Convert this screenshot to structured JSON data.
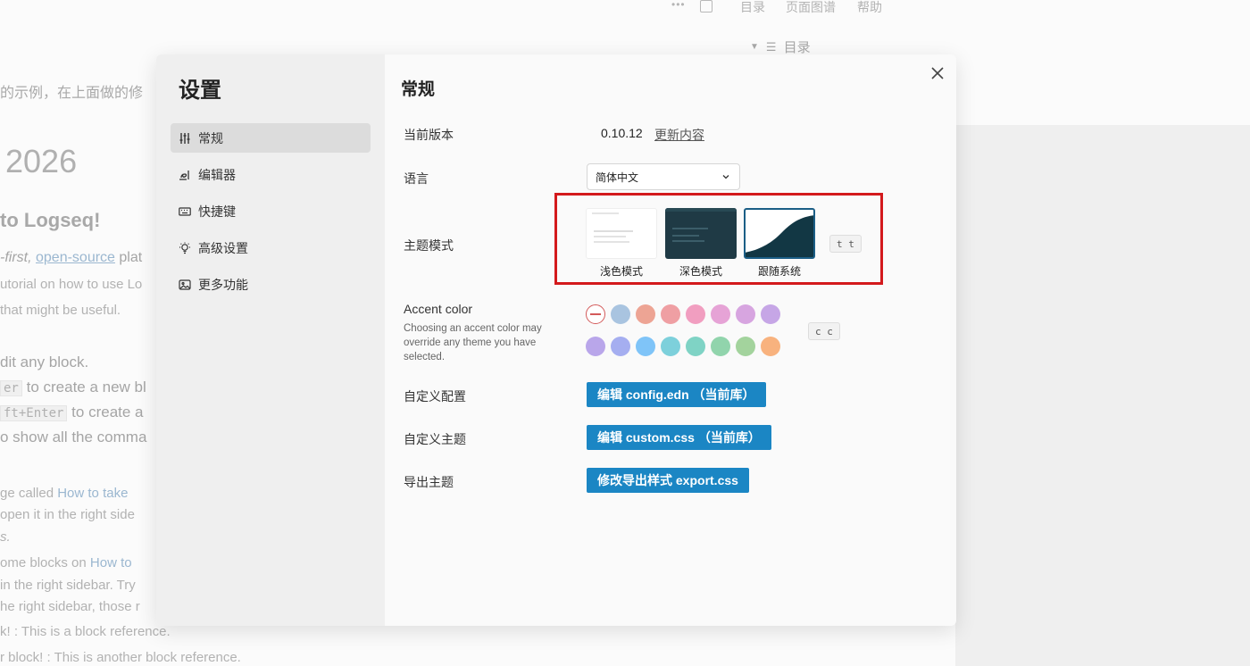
{
  "background": {
    "topbar": {
      "more": "•••",
      "toc": "目录",
      "graph": "页面图谱",
      "help": "帮助"
    },
    "toc_panel_label": "目录",
    "lines": [
      "的示例，在上面做的修",
      "2026",
      "to Logseq!",
      "-first,",
      "open-source",
      "plat",
      "utorial on how to use Lo",
      "that might be useful.",
      "dit any block.",
      "er",
      "to create a new bl",
      "ft+Enter",
      "to create a",
      "o show all the comma",
      "ge called",
      "How to take",
      "open it in the right side",
      "s.",
      "ome blocks on",
      "How to",
      "in the right sidebar. Try",
      "he right sidebar, those r",
      "k! : This is a block reference.",
      "r block! : This is another block reference."
    ]
  },
  "settings": {
    "title": "设置",
    "nav": [
      {
        "label": "常规",
        "icon": "sliders-icon",
        "active": true
      },
      {
        "label": "编辑器",
        "icon": "editor-icon",
        "active": false
      },
      {
        "label": "快捷键",
        "icon": "keyboard-icon",
        "active": false
      },
      {
        "label": "高级设置",
        "icon": "bulb-icon",
        "active": false
      },
      {
        "label": "更多功能",
        "icon": "image-icon",
        "active": false
      }
    ],
    "general": {
      "title": "常规",
      "version_label": "当前版本",
      "version": "0.10.12",
      "changelog": "更新内容",
      "language_label": "语言",
      "language_value": "简体中文",
      "theme_label": "主题模式",
      "themes": [
        "浅色模式",
        "深色模式",
        "跟随系统"
      ],
      "theme_selected": "跟随系统",
      "theme_shortcut": "t t",
      "accent_label": "Accent color",
      "accent_desc": "Choosing an accent color may override any theme you have selected.",
      "accent_shortcut": "c c",
      "accent_colors": [
        "#a9c4e0",
        "#eda494",
        "#ef9fa3",
        "#f19ec0",
        "#e6a3d6",
        "#d7a5e0",
        "#c6a6e6",
        "#b9a6ea",
        "#a5aef0",
        "#7fc4f8",
        "#7dd0db",
        "#7fd3c5",
        "#91d4ac",
        "#a3d39d",
        "#f8b27e"
      ],
      "custom_config_label": "自定义配置",
      "custom_config_button": "编辑 config.edn （当前库）",
      "custom_theme_label": "自定义主题",
      "custom_theme_button": "编辑 custom.css （当前库）",
      "export_theme_label": "导出主题",
      "export_theme_button": "修改导出样式 export.css"
    }
  },
  "colors": {
    "accent_button": "#1b86c4",
    "highlight_box": "#d3191c",
    "active_nav": "#dcdcdc"
  }
}
